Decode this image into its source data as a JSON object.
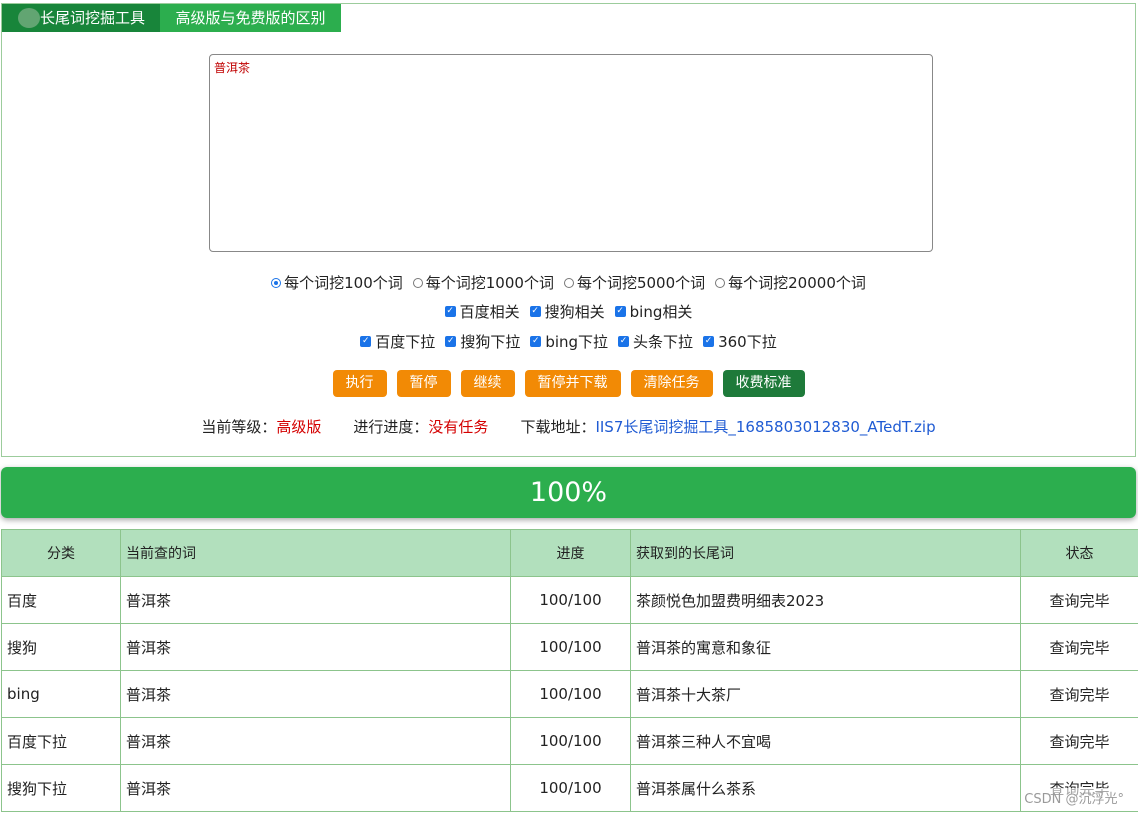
{
  "tabs": [
    {
      "label": "长尾词挖掘工具",
      "active": true
    },
    {
      "label": "高级版与免费版的区别",
      "active": false
    }
  ],
  "keyword_input": {
    "value": "普洱茶"
  },
  "radio_options": [
    {
      "label": "每个词挖100个词",
      "checked": true
    },
    {
      "label": "每个词挖1000个词",
      "checked": false
    },
    {
      "label": "每个词挖5000个词",
      "checked": false
    },
    {
      "label": "每个词挖20000个词",
      "checked": false
    }
  ],
  "related_checks": [
    {
      "label": "百度相关",
      "checked": true
    },
    {
      "label": "搜狗相关",
      "checked": true
    },
    {
      "label": "bing相关",
      "checked": true
    }
  ],
  "dropdown_checks": [
    {
      "label": "百度下拉",
      "checked": true
    },
    {
      "label": "搜狗下拉",
      "checked": true
    },
    {
      "label": "bing下拉",
      "checked": true
    },
    {
      "label": "头条下拉",
      "checked": true
    },
    {
      "label": "360下拉",
      "checked": true
    }
  ],
  "buttons": {
    "execute": "执行",
    "pause": "暂停",
    "resume": "继续",
    "pause_download": "暂停并下载",
    "clear": "清除任务",
    "pricing": "收费标准"
  },
  "status": {
    "level_label": "当前等级：",
    "level_value": "高级版",
    "progress_label": "进行进度：",
    "progress_value": "没有任务",
    "download_label": "下载地址：",
    "download_link": "IIS7长尾词挖掘工具_1685803012830_ATedT.zip"
  },
  "progress": {
    "percent": 100,
    "text": "100%"
  },
  "table": {
    "headers": [
      "分类",
      "当前查的词",
      "进度",
      "获取到的长尾词",
      "状态"
    ],
    "rows": [
      [
        "百度",
        "普洱茶",
        "100/100",
        "茶颜悦色加盟费明细表2023",
        "查询完毕"
      ],
      [
        "搜狗",
        "普洱茶",
        "100/100",
        "普洱茶的寓意和象征",
        "查询完毕"
      ],
      [
        "bing",
        "普洱茶",
        "100/100",
        "普洱茶十大茶厂",
        "查询完毕"
      ],
      [
        "百度下拉",
        "普洱茶",
        "100/100",
        "普洱茶三种人不宜喝",
        "查询完毕"
      ],
      [
        "搜狗下拉",
        "普洱茶",
        "100/100",
        "普洱茶属什么茶系",
        "查询完毕"
      ]
    ]
  },
  "watermark": "CSDN @沉浮光°",
  "colors": {
    "tab_active": "#18853a",
    "tab_inactive": "#2cae4e",
    "button_orange": "#f28a05",
    "button_green": "#1e7a3a",
    "progress_green": "#2cae4e",
    "table_header": "#b2e0bd",
    "highlight_red": "#d40000",
    "link_blue": "#1f5bd3"
  }
}
